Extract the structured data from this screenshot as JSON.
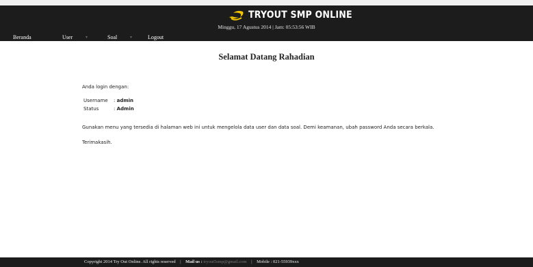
{
  "header": {
    "brand": "TRYOUT SMP ONLINE",
    "datetime": "Minggu, 17 Agustus 2014 | Jam: 05:53:56 WIB"
  },
  "nav": {
    "items": [
      {
        "label": "Beranda"
      },
      {
        "label": "User"
      },
      {
        "label": "Soal"
      },
      {
        "label": "Logout"
      }
    ]
  },
  "main": {
    "title": "Selamat Datang Rahadian",
    "login_intro": "Anda login dengan:",
    "username_label": "Username",
    "username_value": "admin",
    "status_label": "Status",
    "status_value": "Admin",
    "separator": ":",
    "message": "Gunakan menu yang tersedia di halaman web ini untuk mengelola data user dan data soal. Demi keamanan, ubah password Anda secara berkala.",
    "thanks": "Terimakasih."
  },
  "footer": {
    "copyright": "Copyright 2014 Try Out Online. All rights reserved",
    "separator": "|",
    "mail_label": "Mail us :",
    "mail_value": "tryout5smp@gmail.com",
    "mobile": "Mobile : 021-55939xxx"
  },
  "colors": {
    "header_bg": "#1c1c1c",
    "logo_accent": "#f5c400"
  }
}
